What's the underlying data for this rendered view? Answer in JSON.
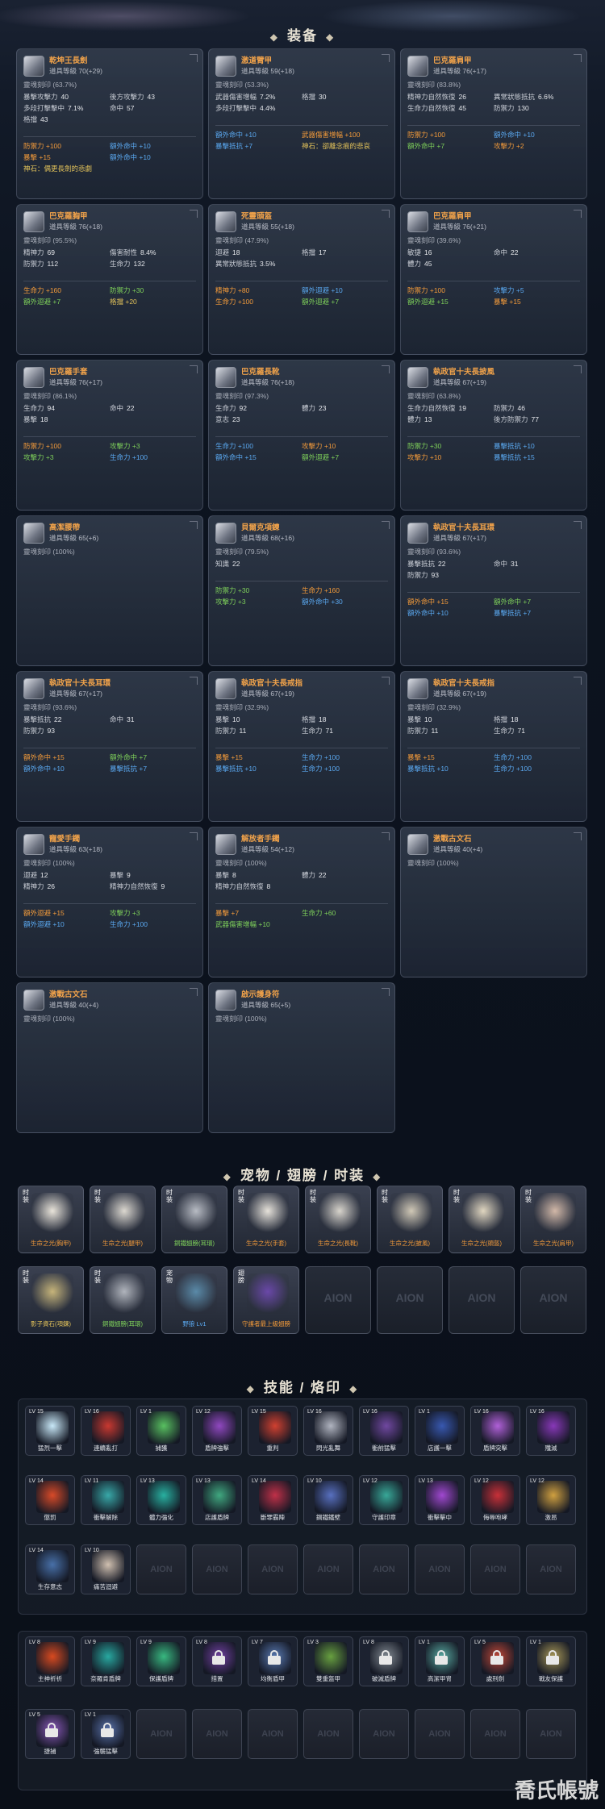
{
  "sections": {
    "equipment": "装备",
    "pets": "宠物 / 翅膀 / 时装",
    "skills": "技能 / 烙印"
  },
  "equipment": [
    {
      "name": "乾坤王長劍",
      "lvl": "道具等級  70(+29)",
      "soul": "靈魂刻印  (63.7%)",
      "stats": [
        [
          "暴擊攻擊力",
          "40"
        ],
        [
          "後方攻擊力",
          "43"
        ],
        [
          "多段打擊擊中",
          "7.1%"
        ],
        [
          "命中",
          "57"
        ],
        [
          "格擋",
          "43"
        ],
        [
          "",
          ""
        ]
      ],
      "bonus": [
        [
          "c-o",
          "防禦力 +100"
        ],
        [
          "c-b",
          "額外命中 +10"
        ],
        [
          "c-o",
          "暴擊 +15"
        ],
        [
          "c-b",
          "額外命中 +10"
        ],
        [
          "c-y",
          "神石：偶更長劍的悲劇"
        ],
        [
          "",
          ""
        ]
      ]
    },
    {
      "name": "激道臂甲",
      "lvl": "道具等級  59(+18)",
      "soul": "靈魂刻印  (53.3%)",
      "stats": [
        [
          "武器傷害增幅",
          "7.2%"
        ],
        [
          "格擋",
          "30"
        ],
        [
          "多段打擊擊中",
          "4.4%"
        ],
        [
          "",
          ""
        ]
      ],
      "bonus": [
        [
          "c-b",
          "額外命中 +10"
        ],
        [
          "c-o",
          "武器傷害增幅 +100"
        ],
        [
          "c-b",
          "暴擊抵抗 +7"
        ],
        [
          "c-y",
          "神石：卻離念痕的悲哀"
        ]
      ]
    },
    {
      "name": "巴克羅肩甲",
      "lvl": "道具等級  76(+17)",
      "soul": "靈魂刻印  (83.8%)",
      "stats": [
        [
          "精神力自然恢復",
          "26"
        ],
        [
          "異常狀態抵抗",
          "6.6%"
        ],
        [
          "生命力自然恢復",
          "45"
        ],
        [
          "防禦力",
          "130"
        ]
      ],
      "bonus": [
        [
          "c-o",
          "防禦力 +100"
        ],
        [
          "c-b",
          "額外命中 +10"
        ],
        [
          "c-g",
          "額外命中 +7"
        ],
        [
          "c-o",
          "攻擊力 +2"
        ]
      ]
    },
    {
      "name": "巴克羅胸甲",
      "lvl": "道具等級  76(+18)",
      "soul": "靈魂刻印  (95.5%)",
      "stats": [
        [
          "精神力",
          "69"
        ],
        [
          "傷害耐性",
          "8.4%"
        ],
        [
          "防禦力",
          "112"
        ],
        [
          "生命力",
          "132"
        ]
      ],
      "bonus": [
        [
          "c-o",
          "生命力 +160"
        ],
        [
          "c-g",
          "防禦力 +30"
        ],
        [
          "c-g",
          "額外迴避 +7"
        ],
        [
          "c-y",
          "格擋 +20"
        ]
      ]
    },
    {
      "name": "死靈頭盔",
      "lvl": "道具等級  55(+18)",
      "soul": "靈魂刻印  (47.9%)",
      "stats": [
        [
          "迴避",
          "18"
        ],
        [
          "格擋",
          "17"
        ],
        [
          "異常狀態抵抗",
          "3.5%"
        ],
        [
          "",
          ""
        ]
      ],
      "bonus": [
        [
          "c-o",
          "精神力 +80"
        ],
        [
          "c-b",
          "額外迴避 +10"
        ],
        [
          "c-o",
          "生命力 +100"
        ],
        [
          "c-g",
          "額外迴避 +7"
        ]
      ]
    },
    {
      "name": "巴克羅肩甲",
      "lvl": "道具等級  76(+21)",
      "soul": "靈魂刻印  (39.6%)",
      "stats": [
        [
          "敏捷",
          "16"
        ],
        [
          "命中",
          "22"
        ],
        [
          "體力",
          "45"
        ],
        [
          "",
          ""
        ]
      ],
      "bonus": [
        [
          "c-o",
          "防禦力 +100"
        ],
        [
          "c-b",
          "攻擊力 +5"
        ],
        [
          "c-g",
          "額外迴避 +15"
        ],
        [
          "c-o",
          "暴擊 +15"
        ]
      ]
    },
    {
      "name": "巴克羅手套",
      "lvl": "道具等級  76(+17)",
      "soul": "靈魂刻印  (86.1%)",
      "stats": [
        [
          "生命力",
          "94"
        ],
        [
          "命中",
          "22"
        ],
        [
          "暴擊",
          "18"
        ],
        [
          "",
          ""
        ]
      ],
      "bonus": [
        [
          "c-o",
          "防禦力 +100"
        ],
        [
          "c-g",
          "攻擊力 +3"
        ],
        [
          "c-g",
          "攻擊力 +3"
        ],
        [
          "c-b",
          "生命力 +100"
        ]
      ]
    },
    {
      "name": "巴克羅長靴",
      "lvl": "道具等級  76(+18)",
      "soul": "靈魂刻印  (97.3%)",
      "stats": [
        [
          "生命力",
          "92"
        ],
        [
          "體力",
          "23"
        ],
        [
          "意志",
          "23"
        ],
        [
          "",
          ""
        ]
      ],
      "bonus": [
        [
          "c-b",
          "生命力 +100"
        ],
        [
          "c-o",
          "攻擊力 +10"
        ],
        [
          "c-b",
          "額外命中 +15"
        ],
        [
          "c-g",
          "額外迴避 +7"
        ]
      ]
    },
    {
      "name": "執政官十夫長披風",
      "lvl": "道具等級  67(+19)",
      "soul": "靈魂刻印  (63.8%)",
      "stats": [
        [
          "生命力自然恢復",
          "19"
        ],
        [
          "防禦力",
          "46"
        ],
        [
          "體力",
          "13"
        ],
        [
          "後方防禦力",
          "77"
        ]
      ],
      "bonus": [
        [
          "c-g",
          "防禦力 +30"
        ],
        [
          "c-b",
          "暴擊抵抗 +10"
        ],
        [
          "c-o",
          "攻擊力 +10"
        ],
        [
          "c-b",
          "暴擊抵抗 +15"
        ]
      ]
    },
    {
      "name": "高潔腰帶",
      "lvl": "道具等級  65(+6)",
      "soul": "靈魂刻印  (100%)",
      "stats": [],
      "bonus": []
    },
    {
      "name": "貝爾克項鍊",
      "lvl": "道具等級  68(+16)",
      "soul": "靈魂刻印  (79.5%)",
      "stats": [
        [
          "知識",
          "22"
        ],
        [
          "",
          ""
        ]
      ],
      "bonus": [
        [
          "c-g",
          "防禦力 +30"
        ],
        [
          "c-o",
          "生命力 +160"
        ],
        [
          "c-g",
          "攻擊力 +3"
        ],
        [
          "c-b",
          "額外命中 +30"
        ]
      ]
    },
    {
      "name": "執政官十夫長耳環",
      "lvl": "道具等級  67(+17)",
      "soul": "靈魂刻印  (93.6%)",
      "stats": [
        [
          "暴擊抵抗",
          "22"
        ],
        [
          "命中",
          "31"
        ],
        [
          "防禦力",
          "93"
        ],
        [
          "",
          ""
        ]
      ],
      "bonus": [
        [
          "c-o",
          "額外命中 +15"
        ],
        [
          "c-g",
          "額外命中 +7"
        ],
        [
          "c-b",
          "額外命中 +10"
        ],
        [
          "c-b",
          "暴擊抵抗 +7"
        ]
      ]
    },
    {
      "name": "執政官十夫長耳環",
      "lvl": "道具等級  67(+17)",
      "soul": "靈魂刻印  (93.6%)",
      "stats": [
        [
          "暴擊抵抗",
          "22"
        ],
        [
          "命中",
          "31"
        ],
        [
          "防禦力",
          "93"
        ],
        [
          "",
          ""
        ]
      ],
      "bonus": [
        [
          "c-o",
          "額外命中 +15"
        ],
        [
          "c-g",
          "額外命中 +7"
        ],
        [
          "c-b",
          "額外命中 +10"
        ],
        [
          "c-b",
          "暴擊抵抗 +7"
        ]
      ]
    },
    {
      "name": "執政官十夫長戒指",
      "lvl": "道具等級  67(+19)",
      "soul": "靈魂刻印  (32.9%)",
      "stats": [
        [
          "暴擊",
          "10"
        ],
        [
          "格擋",
          "18"
        ],
        [
          "防禦力",
          "11"
        ],
        [
          "生命力",
          "71"
        ]
      ],
      "bonus": [
        [
          "c-o",
          "暴擊 +15"
        ],
        [
          "c-b",
          "生命力 +100"
        ],
        [
          "c-b",
          "暴擊抵抗 +10"
        ],
        [
          "c-b",
          "生命力 +100"
        ]
      ]
    },
    {
      "name": "執政官十夫長戒指",
      "lvl": "道具等級  67(+19)",
      "soul": "靈魂刻印  (32.9%)",
      "stats": [
        [
          "暴擊",
          "10"
        ],
        [
          "格擋",
          "18"
        ],
        [
          "防禦力",
          "11"
        ],
        [
          "生命力",
          "71"
        ]
      ],
      "bonus": [
        [
          "c-o",
          "暴擊 +15"
        ],
        [
          "c-b",
          "生命力 +100"
        ],
        [
          "c-b",
          "暴擊抵抗 +10"
        ],
        [
          "c-b",
          "生命力 +100"
        ]
      ]
    },
    {
      "name": "寵愛手鐲",
      "lvl": "道具等級  63(+18)",
      "soul": "靈魂刻印  (100%)",
      "stats": [
        [
          "迴避",
          "12"
        ],
        [
          "暴擊",
          "9"
        ],
        [
          "精神力",
          "26"
        ],
        [
          "精神力自然恢復",
          "9"
        ]
      ],
      "bonus": [
        [
          "c-o",
          "額外迴避 +15"
        ],
        [
          "c-g",
          "攻擊力 +3"
        ],
        [
          "c-b",
          "額外迴避 +10"
        ],
        [
          "c-b",
          "生命力 +100"
        ]
      ]
    },
    {
      "name": "解放者手鐲",
      "lvl": "道具等級  54(+12)",
      "soul": "靈魂刻印  (100%)",
      "stats": [
        [
          "暴擊",
          "8"
        ],
        [
          "體力",
          "22"
        ],
        [
          "精神力自然恢復",
          "8"
        ],
        [
          "",
          ""
        ]
      ],
      "bonus": [
        [
          "c-o",
          "暴擊 +7"
        ],
        [
          "c-g",
          "生命力 +60"
        ],
        [
          "c-g",
          "武器傷害增幅 +10"
        ],
        [
          "",
          ""
        ]
      ]
    },
    {
      "name": "激戰古文石",
      "lvl": "道具等級  40(+4)",
      "soul": "靈魂刻印  (100%)",
      "stats": [],
      "bonus": []
    },
    {
      "name": "激戰古文石",
      "lvl": "道具等級  40(+4)",
      "soul": "靈魂刻印  (100%)",
      "stats": [],
      "bonus": []
    },
    {
      "name": "啟示護身符",
      "lvl": "道具等級  65(+5)",
      "soul": "靈魂刻印  (100%)",
      "stats": [],
      "bonus": []
    }
  ],
  "pets": [
    {
      "tag": "时装",
      "cap": "生命之光(胸甲)",
      "color": "c-o",
      "art": "#e9e4da"
    },
    {
      "tag": "时装",
      "cap": "生命之光(腿甲)",
      "color": "c-o",
      "art": "#dcd8d0"
    },
    {
      "tag": "时装",
      "cap": "銅鐵翅膀(耳環)",
      "color": "c-g",
      "art": "#b8bcc4"
    },
    {
      "tag": "时装",
      "cap": "生命之光(手套)",
      "color": "c-o",
      "art": "#e6e2da"
    },
    {
      "tag": "时装",
      "cap": "生命之光(長靴)",
      "color": "c-o",
      "art": "#d8d4cc"
    },
    {
      "tag": "时装",
      "cap": "生命之光(披風)",
      "color": "c-o",
      "art": "#d0c8b6"
    },
    {
      "tag": "时装",
      "cap": "生命之光(頭盔)",
      "color": "c-o",
      "art": "#e0d6c0"
    },
    {
      "tag": "时装",
      "cap": "生命之光(肩甲)",
      "color": "c-o",
      "art": "#d2b8a8"
    },
    {
      "tag": "时装",
      "cap": "影子資石(項鍊)",
      "color": "c-y",
      "art": "#c6b47a"
    },
    {
      "tag": "时装",
      "cap": "銅鐵翅膀(耳環)",
      "color": "c-g",
      "art": "#b0b4bc"
    },
    {
      "tag": "宠物",
      "cap": "野狼 Lv1",
      "color": "c-b",
      "art": "#5a8aa8"
    },
    {
      "tag": "翅膀",
      "cap": "守護者最上級翅膀",
      "color": "c-o",
      "art": "#6a48a8"
    }
  ],
  "watermark": "AION",
  "skills": [
    {
      "lv": "LV 15",
      "n": "猛烈一擊",
      "c": "#c8e8f8"
    },
    {
      "lv": "LV 16",
      "n": "連續亂打",
      "c": "#c83830"
    },
    {
      "lv": "LV 1",
      "n": "捕獲",
      "c": "#58c060"
    },
    {
      "lv": "LV 12",
      "n": "盾牌強擊",
      "c": "#9048c0"
    },
    {
      "lv": "LV 15",
      "n": "重判",
      "c": "#d04030"
    },
    {
      "lv": "LV 16",
      "n": "閃光亂舞",
      "c": "#b0b4c0"
    },
    {
      "lv": "LV 16",
      "n": "衝前猛擊",
      "c": "#7048a0"
    },
    {
      "lv": "LV 1",
      "n": "店護一擊",
      "c": "#3858b0"
    },
    {
      "lv": "LV 16",
      "n": "盾牌突擊",
      "c": "#b060d8"
    },
    {
      "lv": "LV 16",
      "n": "殲滅",
      "c": "#8838b8"
    },
    {
      "lv": "LV 14",
      "n": "懲罰",
      "c": "#d84a28"
    },
    {
      "lv": "LV 11",
      "n": "衝擊解除",
      "c": "#38a8a8"
    },
    {
      "lv": "LV 13",
      "n": "體力強化",
      "c": "#28b0a0"
    },
    {
      "lv": "LV 13",
      "n": "店護盾牌",
      "c": "#40a880"
    },
    {
      "lv": "LV 14",
      "n": "斷罪霸陣",
      "c": "#c03048"
    },
    {
      "lv": "LV 10",
      "n": "鋼鐵鐵壁",
      "c": "#5870c0"
    },
    {
      "lv": "LV 12",
      "n": "守護印章",
      "c": "#38a898"
    },
    {
      "lv": "LV 13",
      "n": "衝擊擊中",
      "c": "#a048d0"
    },
    {
      "lv": "LV 12",
      "n": "侮辱咆哮",
      "c": "#c83038"
    },
    {
      "lv": "LV 12",
      "n": "激昂",
      "c": "#d0a040"
    },
    {
      "lv": "LV 14",
      "n": "生存意志",
      "c": "#4870a8"
    },
    {
      "lv": "LV 10",
      "n": "痛苦迴避",
      "c": "#d0c0b0"
    },
    {
      "e": true
    },
    {
      "e": true
    },
    {
      "e": true
    },
    {
      "e": true
    },
    {
      "e": true
    },
    {
      "e": true
    },
    {
      "e": true
    },
    {
      "e": true
    }
  ],
  "stigmas": [
    {
      "lv": "LV 8",
      "n": "主神祈祈",
      "c": "#d84a20"
    },
    {
      "lv": "LV 9",
      "n": "奈羅肯盾牌",
      "c": "#28a8a0"
    },
    {
      "lv": "LV 9",
      "n": "保護盾牌",
      "c": "#38b880"
    },
    {
      "lv": "LV 8",
      "n": "措置",
      "c": "#7040a0",
      "lock": true
    },
    {
      "lv": "LV 7",
      "n": "均衡盾甲",
      "c": "#5878b0",
      "lock": true
    },
    {
      "lv": "LV 3",
      "n": "雙重盔甲",
      "c": "#68a040"
    },
    {
      "lv": "LV 8",
      "n": "破滅盾牌",
      "c": "#808890",
      "lock": true
    },
    {
      "lv": "LV 1",
      "n": "高潔甲冑",
      "c": "#58a8a0",
      "lock": true
    },
    {
      "lv": "LV 5",
      "n": "處刑劍",
      "c": "#c04838",
      "lock": true
    },
    {
      "lv": "LV 1",
      "n": "戰友保護",
      "c": "#a89858",
      "lock": true
    },
    {
      "lv": "LV 5",
      "n": "捷捕",
      "c": "#8858b8",
      "lock": true
    },
    {
      "lv": "LV 1",
      "n": "強襲猛擊",
      "c": "#5870a8",
      "lock": true
    },
    {
      "e": true
    },
    {
      "e": true
    },
    {
      "e": true
    },
    {
      "e": true
    },
    {
      "e": true
    },
    {
      "e": true
    },
    {
      "e": true
    },
    {
      "e": true
    }
  ],
  "corner_mark": "喬氏帳號"
}
